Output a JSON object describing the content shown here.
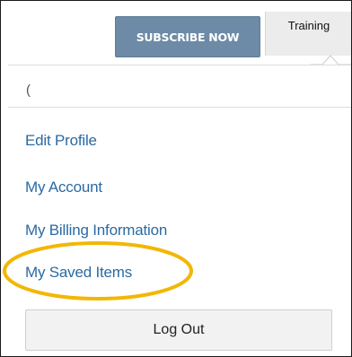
{
  "header": {
    "subscribe_label": "SUBSCRIBE NOW",
    "training_label": "Training"
  },
  "search": {
    "value": "("
  },
  "menu": {
    "items": [
      {
        "label": "Edit Profile"
      },
      {
        "label": "My Account"
      },
      {
        "label": "My Billing Information"
      },
      {
        "label": "My Saved Items"
      }
    ],
    "logout_label": "Log Out"
  },
  "colors": {
    "subscribe_bg": "#6d8aa6",
    "link": "#2b6aa3",
    "highlight": "#f2b705"
  }
}
